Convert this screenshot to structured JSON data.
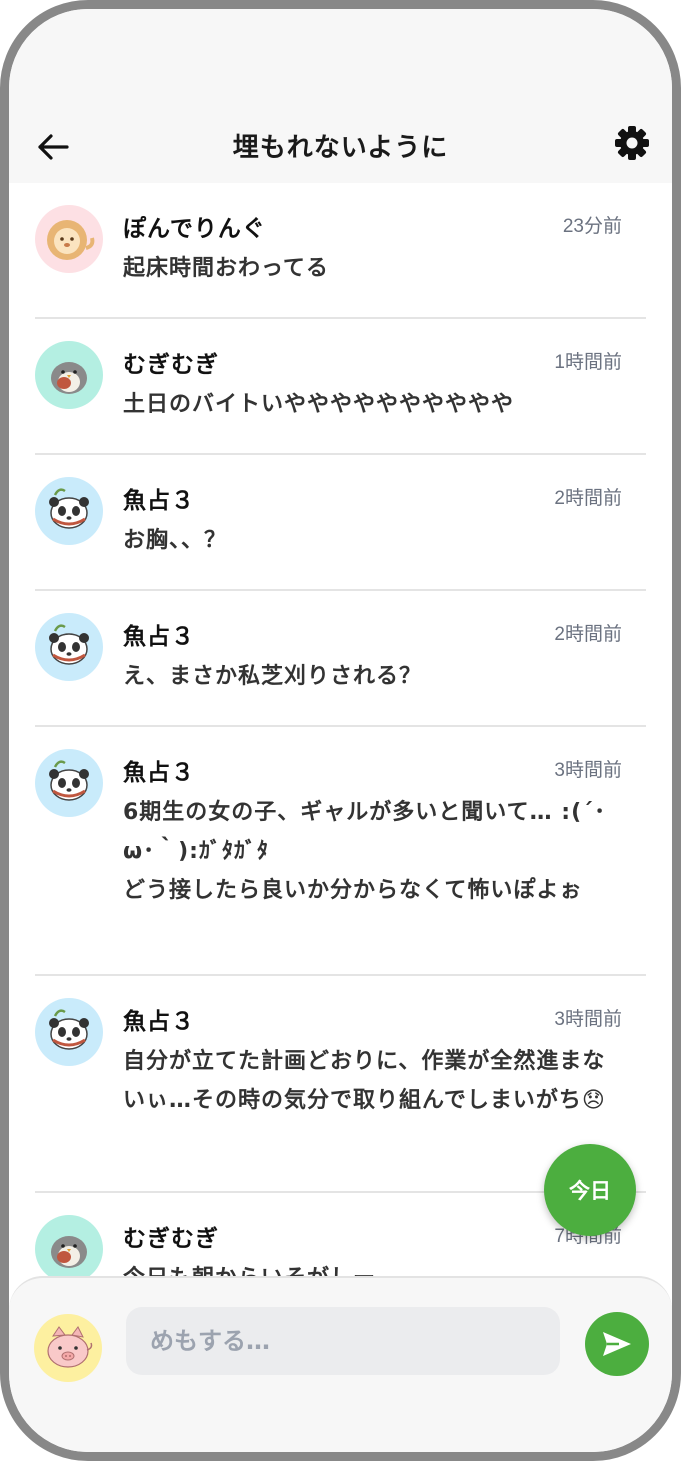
{
  "header": {
    "title": "埋もれないように",
    "back_icon": "arrow-left-icon",
    "settings_icon": "gear-icon"
  },
  "posts": [
    {
      "name": "ぽんでりんぐ",
      "time": "23分前",
      "text": "起床時間おわってる",
      "avatar": "lion-avatar",
      "avatar_bg": "#fde0e4"
    },
    {
      "name": "むぎむぎ",
      "time": "1時間前",
      "text": "土日のバイトいやややややややややや",
      "avatar": "sparrow-avatar",
      "avatar_bg": "#b4efe2"
    },
    {
      "name": "魚占３",
      "time": "2時間前",
      "text": "お胸、、？",
      "avatar": "panda-avatar",
      "avatar_bg": "#c9ebfb"
    },
    {
      "name": "魚占３",
      "time": "2時間前",
      "text": "え、まさか私芝刈りされる？",
      "avatar": "panda-avatar",
      "avatar_bg": "#c9ebfb"
    },
    {
      "name": "魚占３",
      "time": "3時間前",
      "text": "6期生の女の子、ギャルが多いと聞いて… :(´･ω･｀):ｶﾞﾀｶﾞﾀ\nどう接したら良いか分からなくて怖いぽよぉ",
      "avatar": "panda-avatar",
      "avatar_bg": "#c9ebfb"
    },
    {
      "name": "魚占３",
      "time": "3時間前",
      "text": "自分が立てた計画どおりに、作業が全然進まないぃ…その時の気分で取り組んでしまいがち😞",
      "avatar": "panda-avatar",
      "avatar_bg": "#c9ebfb"
    },
    {
      "name": "むぎむぎ",
      "time": "7時間前",
      "text": "今日も朝からいそがしー",
      "avatar": "sparrow-avatar",
      "avatar_bg": "#b4efe2"
    }
  ],
  "fab": {
    "label": "今日"
  },
  "composer": {
    "placeholder": "めもする…",
    "avatar": "pig-avatar",
    "send_icon": "send-icon"
  },
  "colors": {
    "accent": "#4cae3f",
    "frame": "#888888"
  }
}
